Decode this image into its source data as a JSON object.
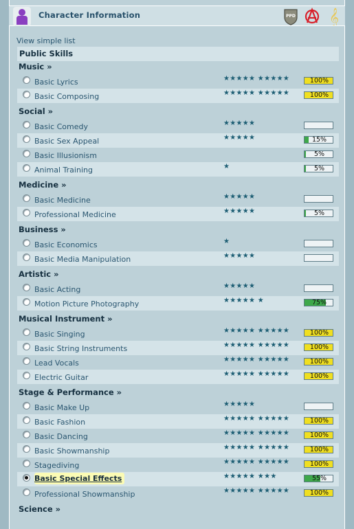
{
  "header": {
    "title": "Character Information",
    "icons": [
      "person-icon",
      "ppd-shield-icon",
      "anarchy-icon",
      "music-note-icon"
    ],
    "ppd_label": "PPD"
  },
  "view_simple_list": "View simple list",
  "public_skills_title": "Public Skills",
  "colors": {
    "full_bar": "#f0df20",
    "partial_bar": "#3ea84a",
    "selected_highlight": "#fbfbb4"
  },
  "categories": [
    {
      "name": "Music »",
      "skills": [
        {
          "name": "Basic Lyrics",
          "stars": "★★★★★ ★★★★★",
          "progress": 100,
          "label": "100%"
        },
        {
          "name": "Basic Composing",
          "stars": "★★★★★ ★★★★★",
          "progress": 100,
          "label": "100%"
        }
      ]
    },
    {
      "name": "Social »",
      "skills": [
        {
          "name": "Basic Comedy",
          "stars": "★★★★★",
          "progress": 0,
          "label": ""
        },
        {
          "name": "Basic Sex Appeal",
          "stars": "★★★★★",
          "progress": 15,
          "label": "15%"
        },
        {
          "name": "Basic Illusionism",
          "stars": "",
          "progress": 5,
          "label": "5%"
        },
        {
          "name": "Animal Training",
          "stars": "★",
          "progress": 5,
          "label": "5%"
        }
      ]
    },
    {
      "name": "Medicine »",
      "skills": [
        {
          "name": "Basic Medicine",
          "stars": "★★★★★",
          "progress": 0,
          "label": ""
        },
        {
          "name": "Professional Medicine",
          "stars": "★★★★★",
          "progress": 5,
          "label": "5%"
        }
      ]
    },
    {
      "name": "Business »",
      "skills": [
        {
          "name": "Basic Economics",
          "stars": "★",
          "progress": 0,
          "label": ""
        },
        {
          "name": "Basic Media Manipulation",
          "stars": "★★★★★",
          "progress": 0,
          "label": ""
        }
      ]
    },
    {
      "name": "Artistic »",
      "skills": [
        {
          "name": "Basic Acting",
          "stars": "★★★★★",
          "progress": 0,
          "label": ""
        },
        {
          "name": "Motion Picture Photography",
          "stars": "★★★★★ ★",
          "progress": 75,
          "label": "75%"
        }
      ]
    },
    {
      "name": "Musical Instrument »",
      "skills": [
        {
          "name": "Basic Singing",
          "stars": "★★★★★ ★★★★★",
          "progress": 100,
          "label": "100%"
        },
        {
          "name": "Basic String Instruments",
          "stars": "★★★★★ ★★★★★",
          "progress": 100,
          "label": "100%"
        },
        {
          "name": "Lead Vocals",
          "stars": "★★★★★ ★★★★★",
          "progress": 100,
          "label": "100%"
        },
        {
          "name": "Electric Guitar",
          "stars": "★★★★★ ★★★★★",
          "progress": 100,
          "label": "100%"
        }
      ]
    },
    {
      "name": "Stage & Performance »",
      "skills": [
        {
          "name": "Basic Make Up",
          "stars": "★★★★★",
          "progress": 0,
          "label": ""
        },
        {
          "name": "Basic Fashion",
          "stars": "★★★★★ ★★★★★",
          "progress": 100,
          "label": "100%"
        },
        {
          "name": "Basic Dancing",
          "stars": "★★★★★ ★★★★★",
          "progress": 100,
          "label": "100%"
        },
        {
          "name": "Basic Showmanship",
          "stars": "★★★★★ ★★★★★",
          "progress": 100,
          "label": "100%"
        },
        {
          "name": "Stagediving",
          "stars": "★★★★★ ★★★★★",
          "progress": 100,
          "label": "100%"
        },
        {
          "name": "Basic Special Effects",
          "stars": "★★★★★ ★★★",
          "progress": 55,
          "label": "55%",
          "selected": true
        },
        {
          "name": "Professional Showmanship",
          "stars": "★★★★★ ★★★★★",
          "progress": 100,
          "label": "100%"
        }
      ]
    },
    {
      "name": "Science »",
      "skills": []
    }
  ]
}
